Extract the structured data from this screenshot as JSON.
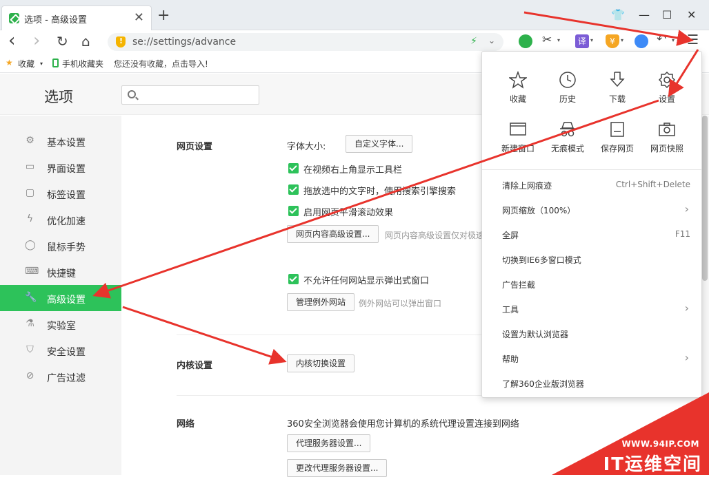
{
  "tab": {
    "title": "选项 - 高级设置",
    "close": "✕"
  },
  "newtab": "+",
  "window": {
    "shirt": "👕",
    "minimize": "—",
    "maximize": "☐",
    "close": "✕"
  },
  "nav": {
    "back": "‹",
    "forward": "›",
    "refresh": "↻",
    "home": "⌂"
  },
  "address": {
    "url": "se://settings/advance",
    "bolt": "⚡",
    "dropdown": "⌄"
  },
  "toolbar": {
    "translate": "译",
    "coin": "¥",
    "undo": "↶",
    "menu": "☰",
    "caret": "▾"
  },
  "bookmarks": {
    "favorites": "收藏",
    "mobile": "手机收藏夹",
    "empty_hint": "您还没有收藏，点击导入!"
  },
  "header": {
    "title": "选项",
    "search_placeholder": ""
  },
  "sidebar": {
    "items": [
      {
        "label": "基本设置",
        "icon": "gear-icon"
      },
      {
        "label": "界面设置",
        "icon": "window-icon"
      },
      {
        "label": "标签设置",
        "icon": "tab-icon"
      },
      {
        "label": "优化加速",
        "icon": "bolt-icon"
      },
      {
        "label": "鼠标手势",
        "icon": "mouse-icon"
      },
      {
        "label": "快捷键",
        "icon": "keyboard-icon"
      },
      {
        "label": "高级设置",
        "icon": "wrench-icon"
      },
      {
        "label": "实验室",
        "icon": "flask-icon"
      },
      {
        "label": "安全设置",
        "icon": "shield-icon"
      },
      {
        "label": "广告过滤",
        "icon": "block-icon"
      }
    ],
    "active_index": 6
  },
  "content": {
    "webpage": {
      "title": "网页设置",
      "font_size_label": "字体大小:",
      "custom_font_button": "自定义字体...",
      "checkboxes": [
        "在视频右上角显示工具栏",
        "拖放选中的文字时，使用搜索引擎搜索",
        "启用网页平滑滚动效果"
      ],
      "advanced_content_button": "网页内容高级设置...",
      "advanced_content_hint": "网页内容高级设置仅对极速",
      "popup_checkbox": "不允许任何网站显示弹出式窗口",
      "manage_exceptions_button": "管理例外网站",
      "exceptions_hint": "例外网站可以弹出窗口"
    },
    "kernel": {
      "title": "内核设置",
      "switch_button": "内核切换设置"
    },
    "network": {
      "title": "网络",
      "description": "360安全浏览器会使用您计算机的系统代理设置连接到网络",
      "proxy_button": "代理服务器设置...",
      "change_proxy_button": "更改代理服务器设置..."
    }
  },
  "menu": {
    "quick_row1": [
      "收藏",
      "历史",
      "下载",
      "设置"
    ],
    "quick_row2": [
      "新建窗口",
      "无痕模式",
      "保存网页",
      "网页快照"
    ],
    "items": [
      {
        "label": "清除上网痕迹",
        "shortcut": "Ctrl+Shift+Delete",
        "submenu": false
      },
      {
        "label": "网页缩放（100%）",
        "shortcut": "",
        "submenu": true
      },
      {
        "label": "全屏",
        "shortcut": "F11",
        "submenu": false
      },
      {
        "label": "切换到IE6多窗口模式",
        "shortcut": "",
        "submenu": false
      },
      {
        "label": "广告拦截",
        "shortcut": "",
        "submenu": false
      },
      {
        "label": "工具",
        "shortcut": "",
        "submenu": true
      },
      {
        "label": "设置为默认浏览器",
        "shortcut": "",
        "submenu": false
      },
      {
        "label": "帮助",
        "shortcut": "",
        "submenu": true
      },
      {
        "label": "了解360企业版浏览器",
        "shortcut": "",
        "submenu": false
      }
    ],
    "submenu_glyph": "›"
  },
  "watermark": {
    "url": "WWW.94IP.COM",
    "brand": "IT运维空间"
  },
  "colors": {
    "accent": "#2dc25a",
    "arrow": "#e8332c"
  }
}
